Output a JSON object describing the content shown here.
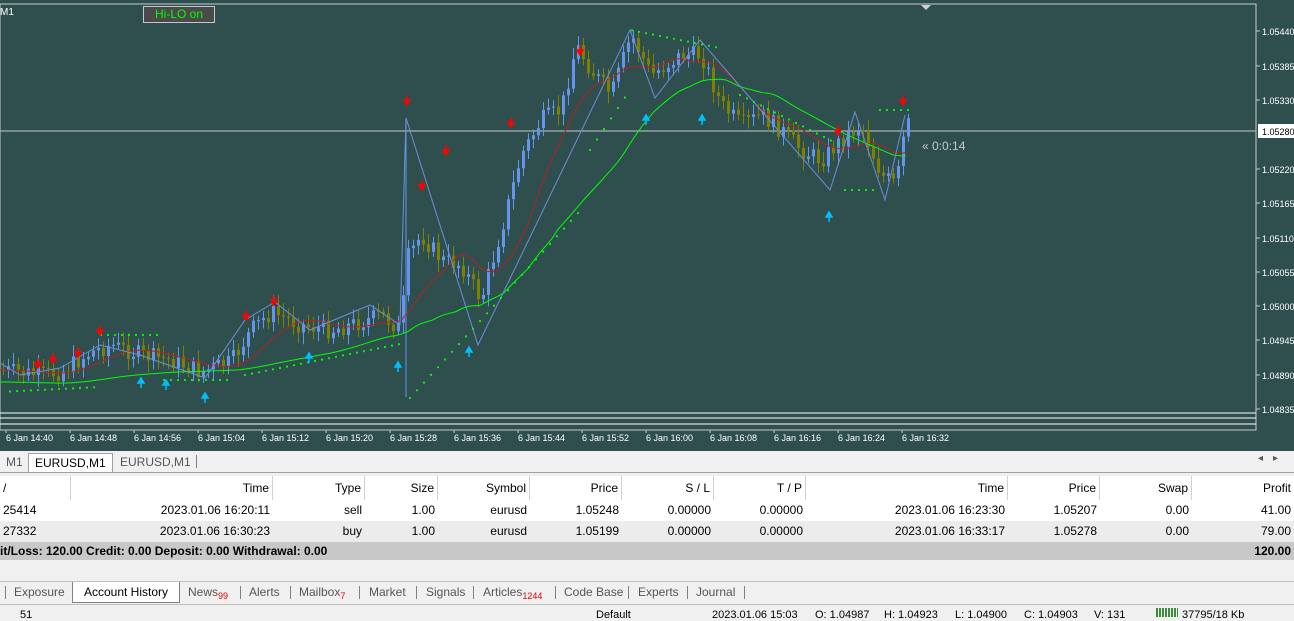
{
  "chart": {
    "symbol_label": "M1",
    "hilo_button": "Hi-LO on",
    "countdown": "« 0:0:14",
    "price_labels": [
      "1.05440",
      "1.05385",
      "1.05330",
      "1.05280",
      "1.05220",
      "1.05165",
      "1.05110",
      "1.05055",
      "1.05000",
      "1.04945",
      "1.04890",
      "1.04835"
    ],
    "current_price": "1.05280",
    "time_labels": [
      "6 Jan 14:40",
      "6 Jan 14:48",
      "6 Jan 14:56",
      "6 Jan 15:04",
      "6 Jan 15:12",
      "6 Jan 15:20",
      "6 Jan 15:28",
      "6 Jan 15:36",
      "6 Jan 15:44",
      "6 Jan 15:52",
      "6 Jan 16:00",
      "6 Jan 16:08",
      "6 Jan 16:16",
      "6 Jan 16:24",
      "6 Jan 16:32"
    ],
    "colors": {
      "background": "#2f4f4f",
      "bull": "#6495ed",
      "bear": "#808000",
      "ma_fast": "#00ff00",
      "ma_slow": "#b22222",
      "sar": "#00ff00",
      "arrow_up": "#00bfff",
      "arrow_down": "#ff0000"
    }
  },
  "chart_tabs": [
    "M1",
    "EURUSD,M1",
    "EURUSD,M1"
  ],
  "table": {
    "headers": [
      "/",
      "Time",
      "Type",
      "Size",
      "Symbol",
      "Price",
      "S / L",
      "T / P",
      "Time",
      "Price",
      "Swap",
      "Profit"
    ],
    "rows": [
      {
        "order": "25414",
        "time": "2023.01.06 16:20:11",
        "type": "sell",
        "size": "1.00",
        "symbol": "eurusd",
        "price": "1.05248",
        "sl": "0.00000",
        "tp": "0.00000",
        "close_time": "2023.01.06 16:23:30",
        "close_price": "1.05207",
        "swap": "0.00",
        "profit": "41.00"
      },
      {
        "order": "27332",
        "time": "2023.01.06 16:30:23",
        "type": "buy",
        "size": "1.00",
        "symbol": "eurusd",
        "price": "1.05199",
        "sl": "0.00000",
        "tp": "0.00000",
        "close_time": "2023.01.06 16:33:17",
        "close_price": "1.05278",
        "swap": "0.00",
        "profit": "79.00"
      }
    ],
    "summary": "it/Loss: 120.00  Credit: 0.00  Deposit: 0.00  Withdrawal: 0.00",
    "summary_total": "120.00"
  },
  "bottom_tabs": {
    "exposure": "Exposure",
    "account_history": "Account History",
    "news": "News",
    "news_count": "99",
    "alerts": "Alerts",
    "mailbox": "Mailbox",
    "mailbox_count": "7",
    "market": "Market",
    "signals": "Signals",
    "articles": "Articles",
    "articles_count": "1244",
    "code_base": "Code Base",
    "experts": "Experts",
    "journal": "Journal"
  },
  "status": {
    "left": "51",
    "profile": "Default",
    "datetime": "2023.01.06 15:03",
    "open": "O: 1.04987",
    "high": "H: 1.04923",
    "low": "L: 1.04900",
    "close": "C: 1.04903",
    "volume": "V: 131",
    "traffic": "37795/18 Kb"
  }
}
